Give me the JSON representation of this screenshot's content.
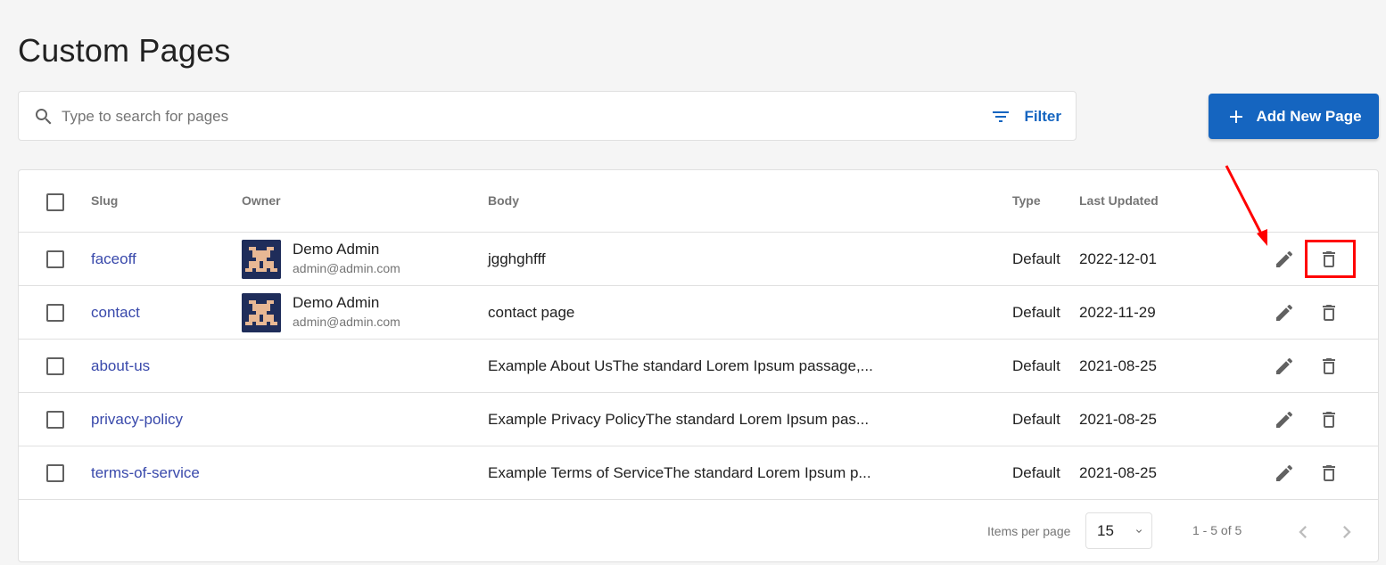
{
  "page": {
    "title": "Custom Pages"
  },
  "search": {
    "placeholder": "Type to search for pages",
    "filter_label": "Filter"
  },
  "actions": {
    "add_label": "Add New Page"
  },
  "table": {
    "columns": {
      "slug": "Slug",
      "owner": "Owner",
      "body": "Body",
      "type": "Type",
      "updated": "Last Updated"
    },
    "rows": [
      {
        "slug": "faceoff",
        "owner_name": "Demo Admin",
        "owner_email": "admin@admin.com",
        "body": "jgghghfff",
        "type": "Default",
        "updated": "2022-12-01"
      },
      {
        "slug": "contact",
        "owner_name": "Demo Admin",
        "owner_email": "admin@admin.com",
        "body": "contact page",
        "type": "Default",
        "updated": "2022-11-29"
      },
      {
        "slug": "about-us",
        "owner_name": "",
        "owner_email": "",
        "body": "Example About UsThe standard Lorem Ipsum passage,...",
        "type": "Default",
        "updated": "2021-08-25"
      },
      {
        "slug": "privacy-policy",
        "owner_name": "",
        "owner_email": "",
        "body": "Example Privacy PolicyThe standard Lorem Ipsum pas...",
        "type": "Default",
        "updated": "2021-08-25"
      },
      {
        "slug": "terms-of-service",
        "owner_name": "",
        "owner_email": "",
        "body": "Example Terms of ServiceThe standard Lorem Ipsum p...",
        "type": "Default",
        "updated": "2021-08-25"
      }
    ],
    "row_icons": {
      "edit": "pencil-icon",
      "delete": "trash-icon"
    }
  },
  "pagination": {
    "items_per_page_label": "Items per page",
    "items_per_page_value": "15",
    "range": "1 - 5 of 5"
  },
  "colors": {
    "accent": "#1565c0",
    "link": "#3949ab",
    "annotation": "#ff0000"
  }
}
